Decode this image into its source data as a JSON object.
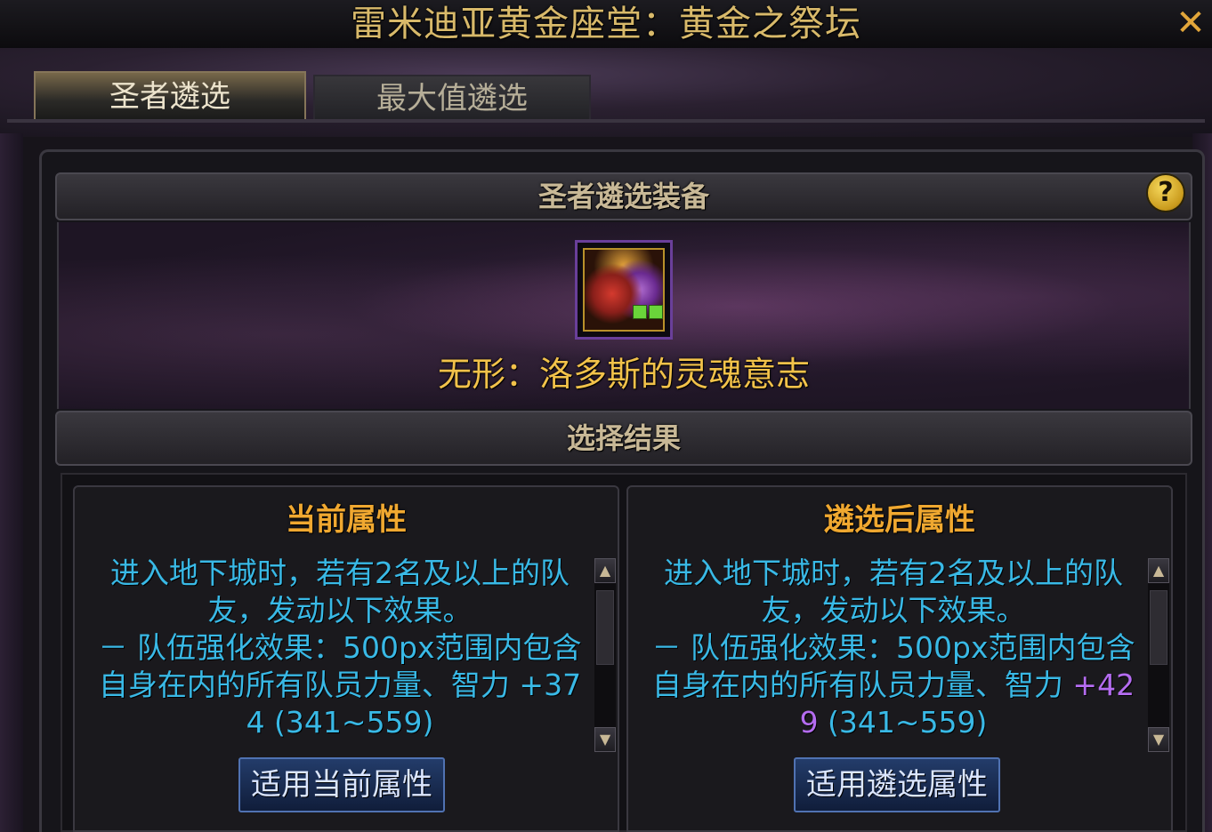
{
  "window": {
    "title": "雷米迪亚黄金座堂：黄金之祭坛",
    "close_glyph": "✕"
  },
  "tabs": [
    {
      "label": "圣者遴选",
      "active": true
    },
    {
      "label": "最大值遴选",
      "active": false
    }
  ],
  "equipment_section": {
    "header": "圣者遴选装备",
    "help_glyph": "?",
    "item_icon": "soul-will-item-icon",
    "item_name": "无形：洛多斯的灵魂意志"
  },
  "result_section": {
    "header": "选择结果",
    "current": {
      "title": "当前属性",
      "line1": "进入地下城时，若有2名及以上的队",
      "line2": "友，发动以下效果。",
      "line3": "－ 队伍强化效果：500px范围内包含",
      "line4_prefix": "自身在内的所有队员力量、智力 ",
      "value_a": "+37",
      "value_b": "4",
      "range": " (341~559)",
      "button": "适用当前属性"
    },
    "after": {
      "title": "遴选后属性",
      "line1": "进入地下城时，若有2名及以上的队",
      "line2": "友，发动以下效果。",
      "line3": "－ 队伍强化效果：500px范围内包含",
      "line4_prefix": "自身在内的所有队员力量、智力 ",
      "value_a": "+42",
      "value_b": "9",
      "range": " (341~559)",
      "button": "适用遴选属性"
    }
  },
  "colors": {
    "title": "#d8b96a",
    "item_name": "#f2c24a",
    "column_title": "#f0a830",
    "description": "#39b9e6",
    "increased_value": "#b46cf0",
    "button_border": "#5072b2"
  }
}
